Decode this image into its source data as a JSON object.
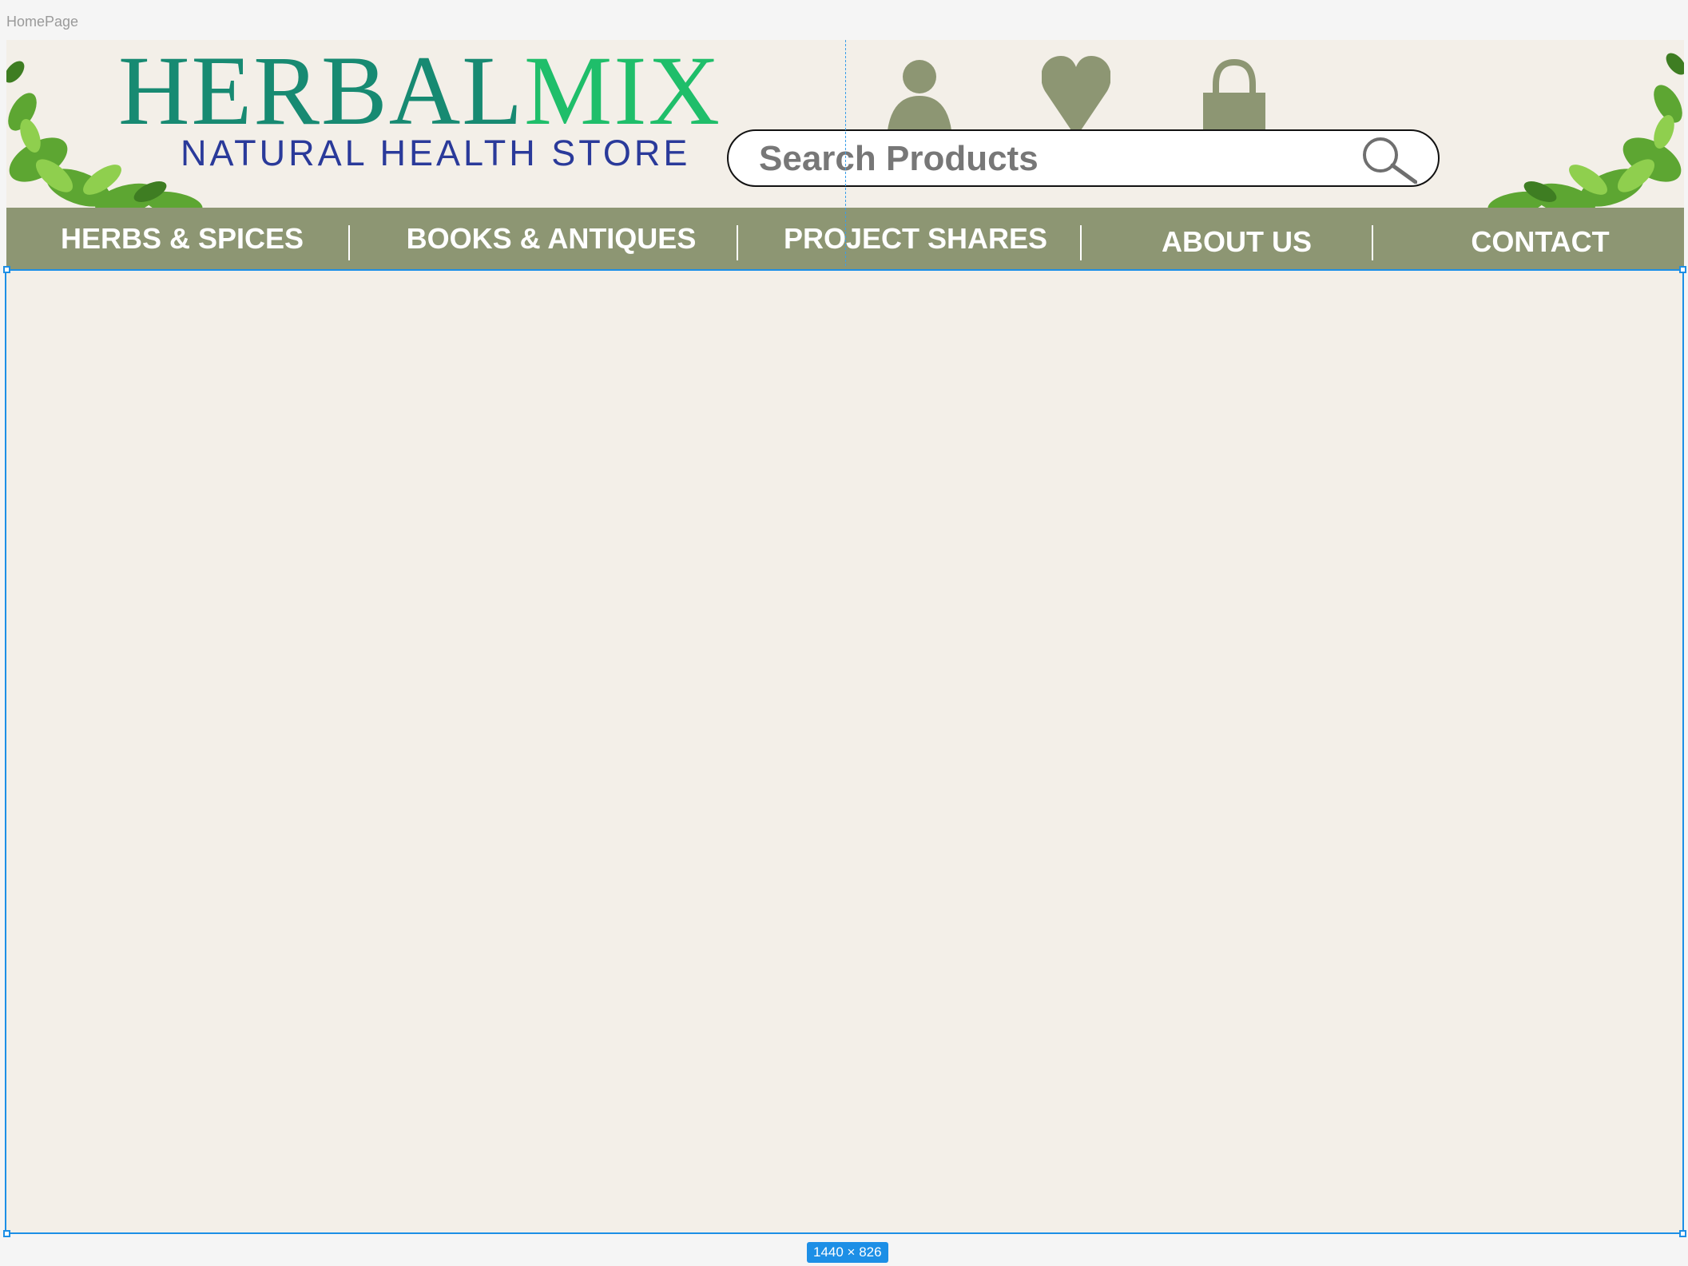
{
  "frame": {
    "label": "HomePage",
    "size_badge": "1440 × 826"
  },
  "brand": {
    "name_part1": "HERBAL",
    "name_part2": "MIX",
    "tagline": "NATURAL HEALTH STORE"
  },
  "header_icons": [
    {
      "name": "account",
      "icon": "user-icon"
    },
    {
      "name": "wishlist",
      "icon": "heart-icon"
    },
    {
      "name": "cart",
      "icon": "shopping-bag-icon"
    }
  ],
  "search": {
    "placeholder": "Search Products",
    "value": "",
    "icon": "search-icon"
  },
  "nav": {
    "items": [
      "HERBS & SPICES",
      "BOOKS & ANTIQUES",
      "PROJECT SHARES",
      "ABOUT US",
      "CONTACT"
    ]
  },
  "colors": {
    "page_bg": "#f3efe8",
    "nav_bg": "#8d9673",
    "icon": "#8d9673",
    "logo_primary": "#178a72",
    "logo_accent": "#1fbe6a",
    "tagline": "#2a3a9a",
    "selection": "#1d8fe6"
  }
}
